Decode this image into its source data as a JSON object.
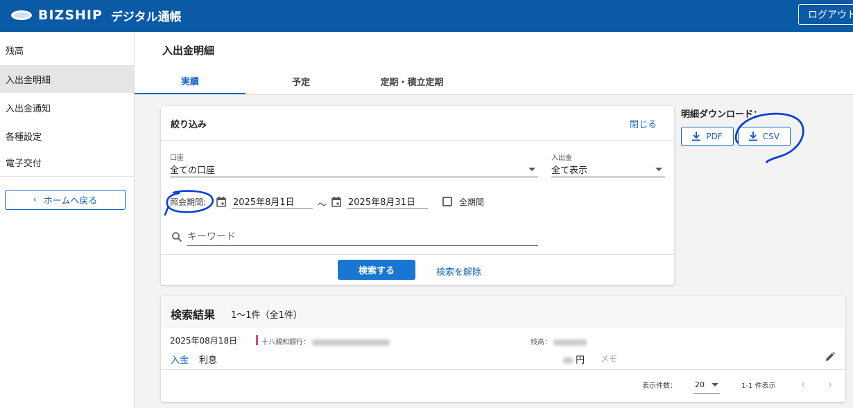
{
  "header": {
    "brand": "BIZSHIP",
    "app_title": "デジタル通帳",
    "logout_label": "ログアウト"
  },
  "sidebar": {
    "items": [
      {
        "label": "残高"
      },
      {
        "label": "入出金明細"
      },
      {
        "label": "入出金通知"
      },
      {
        "label": "各種設定"
      },
      {
        "label": "電子交付"
      }
    ],
    "home_label": "ホームへ戻る"
  },
  "page": {
    "title": "入出金明細",
    "tabs": [
      {
        "label": "実績",
        "active": true
      },
      {
        "label": "予定",
        "active": false
      },
      {
        "label": "定期・積立定期",
        "active": false
      }
    ]
  },
  "filter": {
    "title": "絞り込み",
    "close_label": "閉じる",
    "account_label": "口座",
    "account_value": "全ての口座",
    "inout_label": "入出金",
    "inout_value": "全て表示",
    "period_label": "照会期間:",
    "date_from": "2025年8月1日",
    "tilde": "～",
    "date_to": "2025年8月31日",
    "all_period_label": "全期間",
    "keyword_placeholder": "キーワード",
    "search_label": "検索する",
    "clear_label": "検索を解除"
  },
  "download": {
    "title": "明細ダウンロード：",
    "pdf_label": "PDF",
    "csv_label": "CSV"
  },
  "results": {
    "title": "検索結果",
    "count": "1〜1件（全1件）",
    "rows": [
      {
        "date": "2025年08月18日",
        "bank": "十八親和銀行：",
        "balance_label": "残高：",
        "type": "入金",
        "description": "利息",
        "amount_unit": "円",
        "memo_label": "メモ"
      }
    ],
    "per_page_label": "表示件数：",
    "per_page_value": "20",
    "range_label": "1-1 件表示"
  },
  "colors": {
    "header_bg": "#0b5aa6",
    "accent": "#1565c0",
    "primary_button": "#1976d2",
    "annotation": "#0a3fd6",
    "deposit_marker": "#d6428e"
  }
}
